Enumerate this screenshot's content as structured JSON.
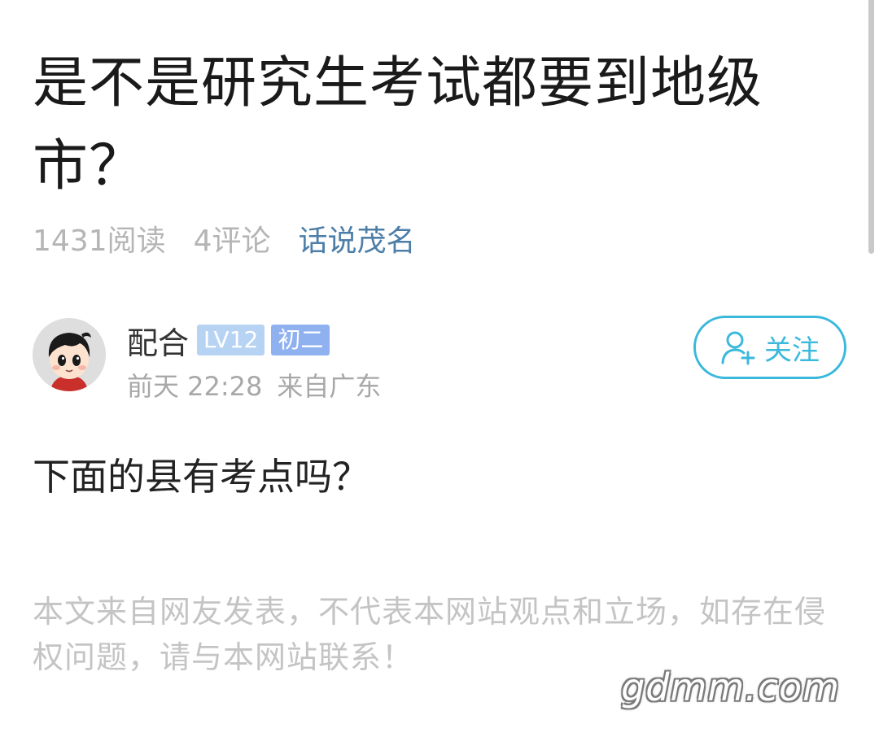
{
  "post": {
    "title": "是不是研究生考试都要到地级市？",
    "reads": "1431阅读",
    "comments": "4评论",
    "forum": "话说茂名"
  },
  "author": {
    "name": "配合",
    "level_badge": "LV12",
    "grade_badge": "初二",
    "time": "前天 22:28",
    "location": "来自广东",
    "follow_label": "关注",
    "avatar_icon": "cartoon-boy-avatar",
    "follow_icon": "add-user-icon",
    "colors": {
      "follow": "#3bb9dc",
      "level_badge": "#b7d3f4",
      "grade_badge": "#8fb1ef",
      "forum_link": "#4d7ea8"
    }
  },
  "body": {
    "text": "下面的县有考点吗？"
  },
  "disclaimer": "本文来自网友发表，不代表本网站观点和立场，如存在侵权问题，请与本网站联系！",
  "watermark": "gdmm.com"
}
